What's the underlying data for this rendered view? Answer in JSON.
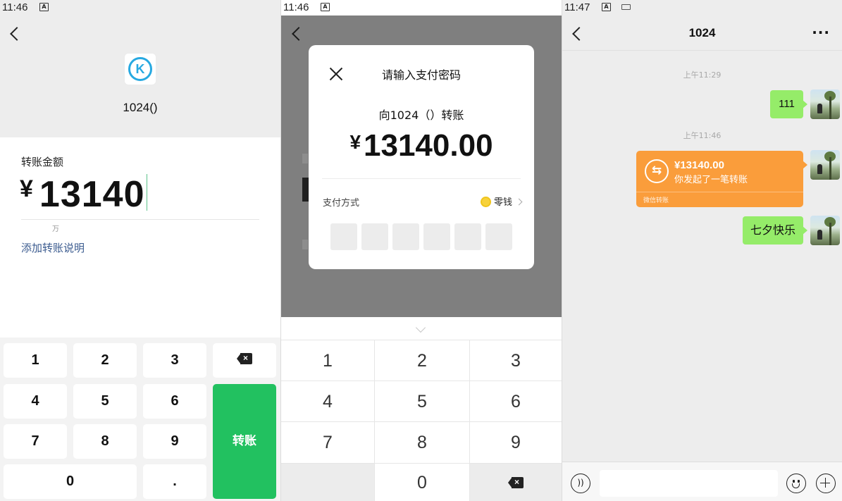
{
  "screen1": {
    "status": {
      "time": "11:46",
      "notif": "A"
    },
    "payee": "1024()",
    "avatar_letter": "K",
    "amount_label": "转账金额",
    "currency": "¥",
    "amount": "13140",
    "unit_hint": "万",
    "add_note": "添加转账说明",
    "keys": {
      "k1": "1",
      "k2": "2",
      "k3": "3",
      "k4": "4",
      "k5": "5",
      "k6": "6",
      "k7": "7",
      "k8": "8",
      "k9": "9",
      "k0": "0",
      "dot": ".",
      "confirm": "转账"
    }
  },
  "screen2": {
    "status": {
      "time": "11:46",
      "notif": "A"
    },
    "dialog": {
      "title": "请输入支付密码",
      "payee": "向1024（）转账",
      "currency": "¥",
      "amount": "13140.00",
      "pay_method_label": "支付方式",
      "pay_method_value": "零钱"
    },
    "keys": {
      "k1": "1",
      "k2": "2",
      "k3": "3",
      "k4": "4",
      "k5": "5",
      "k6": "6",
      "k7": "7",
      "k8": "8",
      "k9": "9",
      "k0": "0"
    }
  },
  "screen3": {
    "status": {
      "time": "11:47",
      "notif": "A"
    },
    "chat_title": "1024",
    "more": "···",
    "ts1": "上午11:29",
    "msg1": "111",
    "ts2": "上午11:46",
    "transfer": {
      "amount": "¥13140.00",
      "desc": "你发起了一笔转账",
      "footer": "微信转账"
    },
    "msg2": "七夕快乐"
  },
  "colors": {
    "wechat_green": "#22c160",
    "bubble_green": "#95ec69",
    "transfer_orange": "#fa9d3b",
    "link_blue": "#3b5b8f"
  }
}
